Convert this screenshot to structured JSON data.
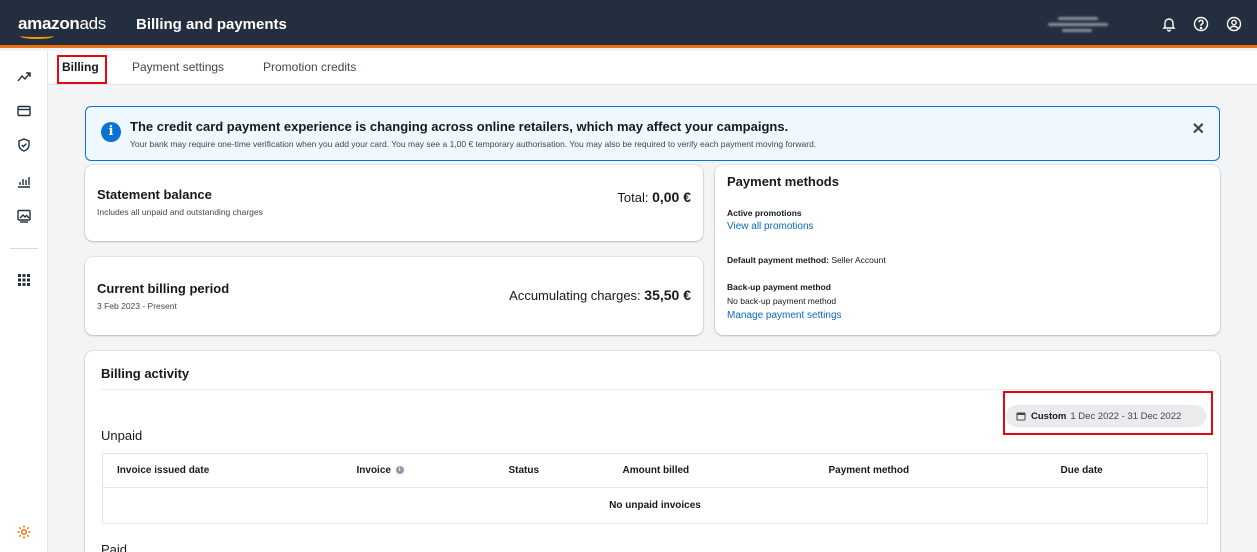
{
  "header": {
    "logo_bold": "amazon",
    "logo_rest": "ads",
    "title": "Billing and payments",
    "icons": [
      "bell-icon",
      "help-icon",
      "user-icon"
    ]
  },
  "rail": {
    "icons": [
      "trend-icon",
      "card-icon",
      "shield-icon",
      "bar-chart-icon",
      "image-icon",
      "apps-grid-icon",
      "settings-icon"
    ]
  },
  "tabs": [
    {
      "label": "Billing",
      "active": true
    },
    {
      "label": "Payment settings",
      "active": false
    },
    {
      "label": "Promotion credits",
      "active": false
    }
  ],
  "alert": {
    "title": "The credit card payment experience is changing across online retailers, which may affect your campaigns.",
    "message": "Your bank may require one-time verification when you add your card. You may see a 1,00 € temporary authorisation. You may also be required to verify each payment moving forward."
  },
  "statement": {
    "title": "Statement balance",
    "subtitle": "Includes all unpaid and outstanding charges",
    "amount_label": "Total: ",
    "amount": "0,00 €"
  },
  "current_period": {
    "title": "Current billing period",
    "subtitle": "3 Feb 2023 - Present",
    "amount_label": "Accumulating charges: ",
    "amount": "35,50 €"
  },
  "payment_methods": {
    "title": "Payment methods",
    "active_promotions_label": "Active promotions",
    "view_promotions_link": "View all promotions",
    "default_label": "Default payment method:",
    "default_value": " Seller Account",
    "backup_label": "Back-up payment method",
    "backup_value": "No back-up payment method",
    "manage_link": "Manage payment settings"
  },
  "billing_activity": {
    "title": "Billing activity",
    "date_filter_label": "Custom",
    "date_filter_range": "1 Dec 2022 - 31 Dec 2022",
    "unpaid_heading": "Unpaid",
    "columns": [
      "Invoice issued date",
      "Invoice",
      "Status",
      "Amount billed",
      "Payment method",
      "Due date"
    ],
    "empty_message": "No unpaid invoices",
    "paid_heading": "Paid"
  },
  "colors": {
    "topbar": "#232f3e",
    "accent_orange": "#ec7211",
    "link_blue": "#0b6ac0",
    "highlight_red": "#e30613",
    "info_blue": "#0972d3"
  }
}
